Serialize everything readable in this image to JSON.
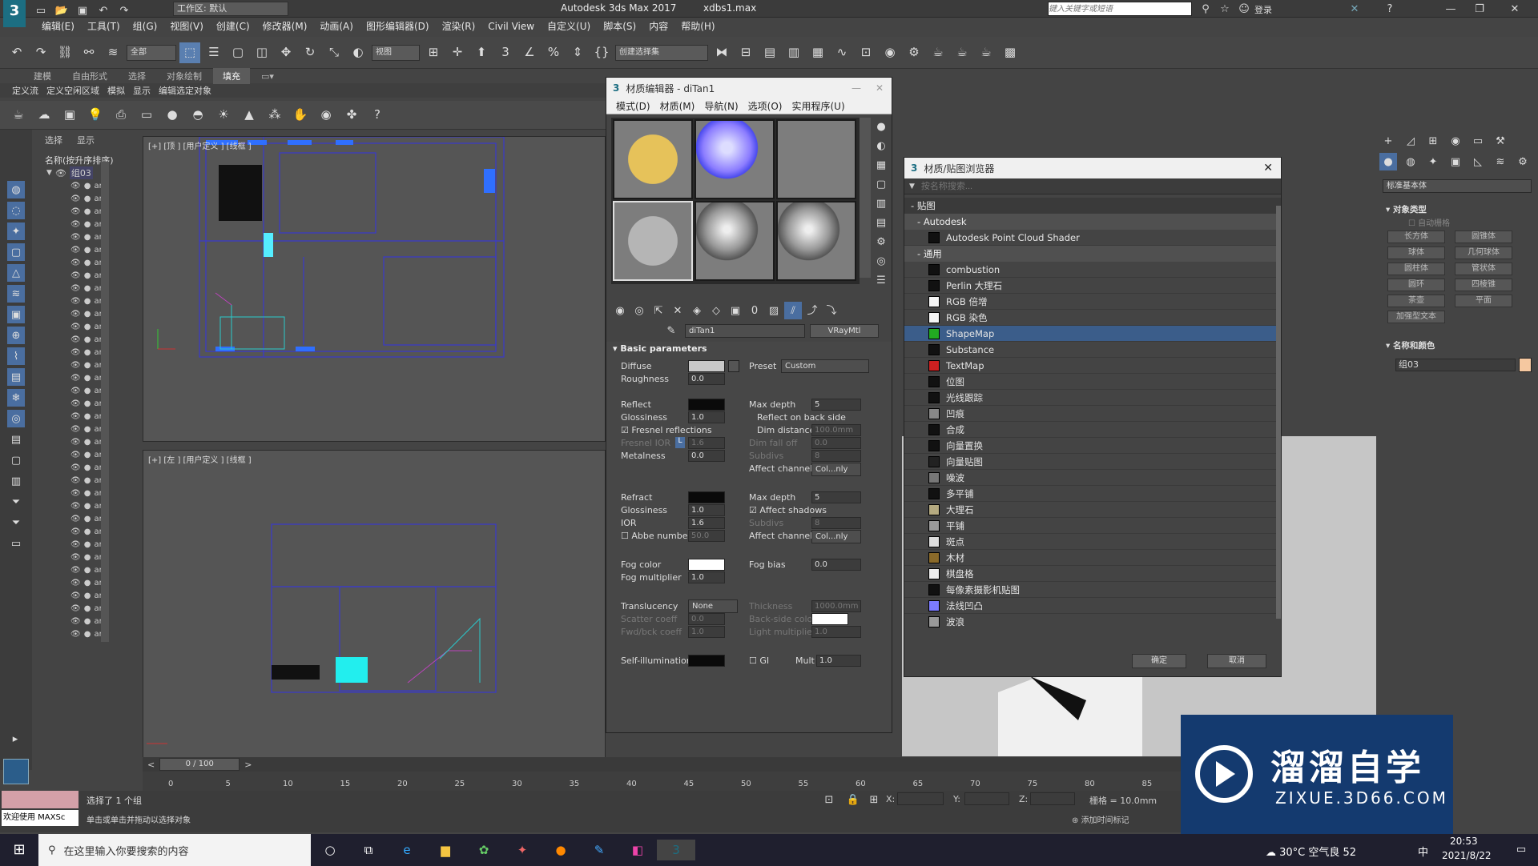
{
  "app": {
    "title": "Autodesk 3ds Max 2017",
    "file": "xdbs1.max",
    "workspace": "工作区: 默认",
    "search_placeholder": "键入关键字或短语",
    "login": "登录"
  },
  "menu": [
    "编辑(E)",
    "工具(T)",
    "组(G)",
    "视图(V)",
    "创建(C)",
    "修改器(M)",
    "动画(A)",
    "图形编辑器(D)",
    "渲染(R)",
    "Civil View",
    "自定义(U)",
    "脚本(S)",
    "内容",
    "帮助(H)"
  ],
  "toolbar": {
    "filter": "全部",
    "refcoord": "视图",
    "selset": "创建选择集"
  },
  "ribbon": {
    "tabs": [
      "建模",
      "自由形式",
      "选择",
      "对象绘制",
      "填充"
    ],
    "active": "填充",
    "sub": [
      "定义流",
      "定义空闲区域",
      "模拟",
      "显示",
      "编辑选定对象"
    ]
  },
  "scene": {
    "tabs": [
      "选择",
      "显示"
    ],
    "header": "名称(按升序排序)",
    "root": "组03",
    "item_prefix": "ar"
  },
  "viewports": {
    "top": "[+] [顶 ] [用户定义 ] [线框 ]",
    "left": "[+] [左 ] [用户定义 ] [线框 ]"
  },
  "material_editor": {
    "title": "材质编辑器 - diTan1",
    "menu": [
      "模式(D)",
      "材质(M)",
      "导航(N)",
      "选项(O)",
      "实用程序(U)"
    ],
    "mat_name": "diTan1",
    "mat_type": "VRayMtl",
    "section": "Basic parameters",
    "diffuse": "Diffuse",
    "roughness": "Roughness",
    "roughness_val": "0.0",
    "preset": "Preset",
    "preset_val": "Custom",
    "reflect": "Reflect",
    "glossiness": "Glossiness",
    "gloss_val": "1.0",
    "max_depth": "Max depth",
    "max_depth_val": "5",
    "reflect_back": "Reflect on back side",
    "fresnel": "Fresnel reflections",
    "dim_distance": "Dim distance",
    "dim_distance_val": "100.0mm",
    "fresnel_ior": "Fresnel IOR",
    "fresnel_ior_lock": "L",
    "fresnel_ior_val": "1.6",
    "dim_falloff": "Dim fall off",
    "dim_falloff_val": "0.0",
    "metalness": "Metalness",
    "metal_val": "0.0",
    "subdivs": "Subdivs",
    "subdivs_val": "8",
    "affect_channels": "Affect channels",
    "channels_val": "Col...nly",
    "refract": "Refract",
    "rgloss_val": "1.0",
    "rmax_val": "5",
    "affect_shadows": "Affect shadows",
    "ior": "IOR",
    "ior_val": "1.6",
    "abbe": "Abbe number",
    "abbe_val": "50.0",
    "fog_color": "Fog color",
    "fog_bias": "Fog bias",
    "fog_bias_val": "0.0",
    "fog_mult": "Fog multiplier",
    "fog_mult_val": "1.0",
    "translucency": "Translucency",
    "trans_val": "None",
    "thickness": "Thickness",
    "thickness_val": "1000.0mm",
    "scatter": "Scatter coeff",
    "scatter_val": "0.0",
    "backside": "Back-side color",
    "fwdbck": "Fwd/bck coeff",
    "fwdbck_val": "1.0",
    "light_mult": "Light multiplier",
    "light_mult_val": "1.0",
    "selfillum": "Self-illumination",
    "gi": "GI",
    "mult": "Mult",
    "mult_val": "1.0"
  },
  "browser": {
    "title": "材质/贴图浏览器",
    "search": "按名称搜索...",
    "group_maps": "贴图",
    "sub_autodesk": "Autodesk",
    "sub_general": "通用",
    "ok": "确定",
    "cancel": "取消",
    "autodesk_items": [
      {
        "label": "Autodesk Point Cloud Shader",
        "color": "#111111"
      }
    ],
    "items": [
      {
        "label": "combustion",
        "color": "#111111"
      },
      {
        "label": "Perlin 大理石",
        "color": "#111111"
      },
      {
        "label": "RGB 倍增",
        "color": "#f5f5f5"
      },
      {
        "label": "RGB 染色",
        "color": "#f5f5f5"
      },
      {
        "label": "ShapeMap",
        "color": "#22aa22"
      },
      {
        "label": "Substance",
        "color": "#111111"
      },
      {
        "label": "TextMap",
        "color": "#cc2020"
      },
      {
        "label": "位图",
        "color": "#111111"
      },
      {
        "label": "光线跟踪",
        "color": "#111111"
      },
      {
        "label": "凹痕",
        "color": "#888888"
      },
      {
        "label": "合成",
        "color": "#111111"
      },
      {
        "label": "向量置换",
        "color": "#111111"
      },
      {
        "label": "向量贴图",
        "color": "#222222"
      },
      {
        "label": "噪波",
        "color": "#777777"
      },
      {
        "label": "多平铺",
        "color": "#111111"
      },
      {
        "label": "大理石",
        "color": "#b5aa80"
      },
      {
        "label": "平铺",
        "color": "#9a9a9a"
      },
      {
        "label": "斑点",
        "color": "#dddddd"
      },
      {
        "label": "木材",
        "color": "#8a6a2a"
      },
      {
        "label": "棋盘格",
        "color": "#eeeeee"
      },
      {
        "label": "每像素摄影机贴图",
        "color": "#111111"
      },
      {
        "label": "法线凹凸",
        "color": "#7b7bff"
      },
      {
        "label": "波浪",
        "color": "#999999"
      }
    ]
  },
  "cmdpanel": {
    "category": "标准基本体",
    "section1": "对象类型",
    "autogrid": "自动栅格",
    "buttons": [
      "长方体",
      "圆锥体",
      "球体",
      "几何球体",
      "圆柱体",
      "管状体",
      "圆环",
      "四棱锥",
      "茶壶",
      "平面",
      "加强型文本"
    ],
    "section2": "名称和颜色",
    "name": "组03",
    "color": "#f5c8a0"
  },
  "timeline": {
    "frame": "0 / 100",
    "ticks": [
      "0",
      "5",
      "10",
      "15",
      "20",
      "25",
      "30",
      "35",
      "40",
      "45",
      "50",
      "55",
      "60",
      "65",
      "70",
      "75",
      "80",
      "85"
    ]
  },
  "status": {
    "welcome": "欢迎使用 MAXSc",
    "selected": "选择了 1 个组",
    "hint": "单击或单击并拖动以选择对象",
    "x": "X:",
    "y": "Y:",
    "z": "Z:",
    "grid": "栅格 = 10.0mm",
    "addtime": "添加时间标记"
  },
  "taskbar": {
    "search": "在这里输入你要搜索的内容",
    "weather": "30°C 空气良 52",
    "time": "20:53",
    "date": "2021/8/22",
    "ime": "中"
  },
  "logo": {
    "cn": "溜溜自学",
    "url": "ZIXUE.3D66.COM"
  }
}
